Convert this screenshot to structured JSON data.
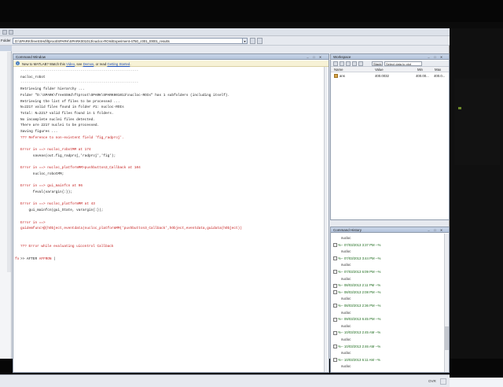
{
  "folder": {
    "label": "Folder",
    "path": "D:\\SPARK\\freeSSHd\\ftproot\\SPARK\\SPARK001013\\nucloc-ROIs\\Experiment-4750_c001_t0001_results"
  },
  "command_window": {
    "title": "Command Window",
    "notice": {
      "prefix": "New to MATLAB? Watch this",
      "video": "Video",
      "see": ", see",
      "demos": "Demos",
      "or_read": ", or read",
      "getting_started": "Getting Started",
      "suffix": "."
    },
    "lines": [
      {
        "text": "---------------------------------------------------------",
        "kind": "dim"
      },
      {
        "text": "nucloc_robot",
        "kind": "normal"
      },
      {
        "text": "---------------------------------------------------------",
        "kind": "dim"
      },
      {
        "text": "Retrieving folder hierarchy ...",
        "kind": "normal"
      },
      {
        "text": "Folder \"D:\\SPARK\\freeSSHd\\ftproot\\SPARK\\SPARK001013\\nucloc-ROIs\" has 1 subfolders (including itself).",
        "kind": "normal"
      },
      {
        "text": "Retrieving the list of files to be processed ...",
        "kind": "normal"
      },
      {
        "text": "N=2217 valid files found in folder #1: nucloc-ROIs",
        "kind": "normal"
      },
      {
        "text": "Total: N=2217 valid files found in 1 folders.",
        "kind": "normal"
      },
      {
        "text": "No incomplete nuclei files detected.",
        "kind": "normal"
      },
      {
        "text": "There are 2217 nuclei to be processed.",
        "kind": "normal"
      },
      {
        "text": "Saving figures ...",
        "kind": "normal"
      },
      {
        "text": "??? Reference to non-existent field 'fig_radproj'.",
        "kind": "err"
      },
      {
        "text": "",
        "kind": "normal"
      },
      {
        "text": "Error in ==> nucloc_robotMM at 174",
        "kind": "link"
      },
      {
        "text": "      saveas(out.fig_radproj,'radproj','fig');",
        "kind": "normal"
      },
      {
        "text": "",
        "kind": "normal"
      },
      {
        "text": "Error in ==> nucloc_platformMM>pushbutton3_Callback at 104",
        "kind": "link"
      },
      {
        "text": "      nucloc_robotMM;",
        "kind": "normal"
      },
      {
        "text": "",
        "kind": "normal"
      },
      {
        "text": "Error in ==> gui_mainfcn at 96",
        "kind": "link"
      },
      {
        "text": "      feval(varargin{:});",
        "kind": "normal"
      },
      {
        "text": "",
        "kind": "normal"
      },
      {
        "text": "Error in ==> nucloc_platformMM at 43",
        "kind": "link"
      },
      {
        "text": "    gui_mainfcn(gui_State, varargin{:});",
        "kind": "normal"
      },
      {
        "text": "",
        "kind": "normal"
      },
      {
        "text": "Error in ==>",
        "kind": "link"
      },
      {
        "text": "guidemfunc>@(hObject,eventdata)nucloc_platformMM('pushbutton3_Callback',hObject,eventdata,guidata(hObject))",
        "kind": "link"
      },
      {
        "text": "",
        "kind": "normal"
      },
      {
        "text": "",
        "kind": "normal"
      },
      {
        "text": "??? Error while evaluating uicontrol Callback",
        "kind": "err"
      },
      {
        "text": "",
        "kind": "normal"
      }
    ],
    "prompt": ">> AFTER",
    "prompt_input": "AFFRON"
  },
  "workspace": {
    "title": "Workspace",
    "stack_label": "Stack:",
    "select_label": "Select data to plot",
    "columns": [
      "Name",
      "Value",
      "Min",
      "Max"
    ],
    "rows": [
      {
        "name": "ans",
        "value": "400.0032",
        "min": "400.00...",
        "max": "400.0..."
      }
    ]
  },
  "command_history": {
    "title": "Command History",
    "entries": [
      {
        "text": "nucloc",
        "session": false
      },
      {
        "text": "%-- 07/03/2013 3:37 PM --%",
        "session": true
      },
      {
        "text": "nucloc",
        "session": false
      },
      {
        "text": "%-- 07/03/2013 3:44 PM --%",
        "session": true
      },
      {
        "text": "nucloc",
        "session": false
      },
      {
        "text": "%-- 07/03/2013 6:09 PM --%",
        "session": true
      },
      {
        "text": "nucloc",
        "session": false
      },
      {
        "text": "%-- 08/03/2013 2:11 PM --%",
        "session": true
      },
      {
        "text": "%-- 08/03/2013 2:08 PM --%",
        "session": true
      },
      {
        "text": "nucloc",
        "session": false
      },
      {
        "text": "%-- 08/03/2013 2:36 PM --%",
        "session": true
      },
      {
        "text": "nucloc",
        "session": false
      },
      {
        "text": "%-- 09/03/2013 6:45 PM --%",
        "session": true
      },
      {
        "text": "nucloc",
        "session": false
      },
      {
        "text": "%-- 10/03/2013 2:45 AM --%",
        "session": true
      },
      {
        "text": "nucloc",
        "session": false
      },
      {
        "text": "%-- 10/03/2013 2:46 AM --%",
        "session": true
      },
      {
        "text": "nucloc",
        "session": false
      },
      {
        "text": "%-- 10/03/2013 6:11 AM --%",
        "session": true
      },
      {
        "text": "nucloc",
        "session": false
      }
    ]
  },
  "status": {
    "mode": "OVR"
  },
  "colors": {
    "error": "#c41a1a",
    "session": "#1b6a1b",
    "link": "#1f4fb8"
  }
}
